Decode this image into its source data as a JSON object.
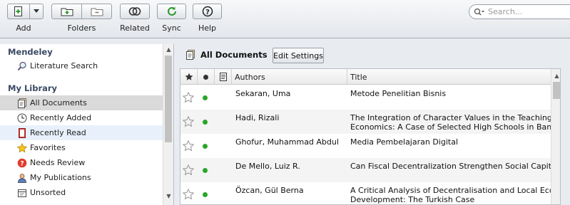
{
  "toolbar": {
    "add_label": "Add",
    "folders_label": "Folders",
    "related_label": "Related",
    "sync_label": "Sync",
    "help_label": "Help"
  },
  "search": {
    "placeholder": "Search..."
  },
  "sidebar": {
    "mendeley_heading": "Mendeley",
    "literature_search": "Literature Search",
    "library_heading": "My Library",
    "items": [
      {
        "label": "All Documents",
        "icon": "documents-icon"
      },
      {
        "label": "Recently Added",
        "icon": "clock-icon"
      },
      {
        "label": "Recently Read",
        "icon": "book-icon"
      },
      {
        "label": "Favorites",
        "icon": "star-icon"
      },
      {
        "label": "Needs Review",
        "icon": "question-icon"
      },
      {
        "label": "My Publications",
        "icon": "person-icon"
      },
      {
        "label": "Unsorted",
        "icon": "unsorted-icon"
      }
    ]
  },
  "main": {
    "title": "All Documents",
    "edit_settings": "Edit Settings",
    "columns": {
      "authors": "Authors",
      "title": "Title"
    },
    "rows": [
      {
        "authors": "Sekaran, Uma",
        "title": "Metode Penelitian Bisnis",
        "title2": ""
      },
      {
        "authors": "Hadi, Rizali",
        "title": "The Integration of Character Values in the Teaching of",
        "title2": "Economics: A Case of Selected High Schools in Banjarmasin"
      },
      {
        "authors": "Ghofur, Muhammad Abdul",
        "title": "Media Pembelajaran Digital",
        "title2": ""
      },
      {
        "authors": "De Mello, Luiz R.",
        "title": "Can Fiscal Decentralization Strengthen Social Capital?",
        "title2": ""
      },
      {
        "authors": "Özcan, Gül Berna",
        "title": "A Critical Analysis of Decentralisation and Local Economic",
        "title2": "Development: The Turkish Case"
      }
    ]
  },
  "colors": {
    "read_dot": "#2aa52a",
    "selected": "#dadada",
    "heading": "#3a4a63"
  }
}
